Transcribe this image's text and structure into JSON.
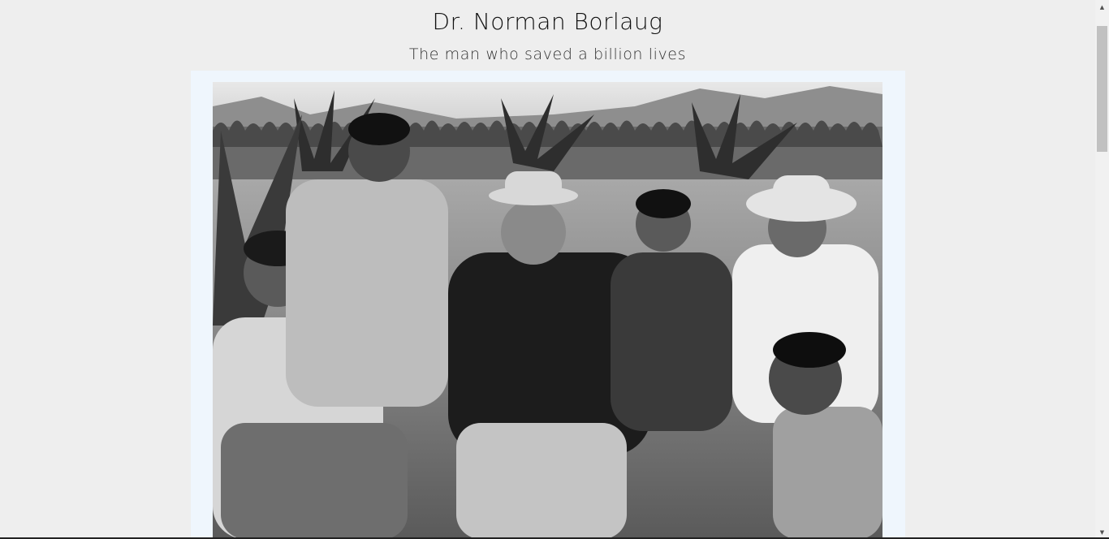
{
  "header": {
    "title": "Dr. Norman Borlaug",
    "subtitle": "The man who saved a billion lives"
  },
  "main": {
    "image": {
      "icon": "photograph-image",
      "style": "black-and-white",
      "colors": {
        "frame": "#eff6fd",
        "page_background": "#eeeeee"
      }
    }
  },
  "scrollbar": {
    "up_icon": "triangle-up",
    "down_icon": "triangle-down"
  }
}
